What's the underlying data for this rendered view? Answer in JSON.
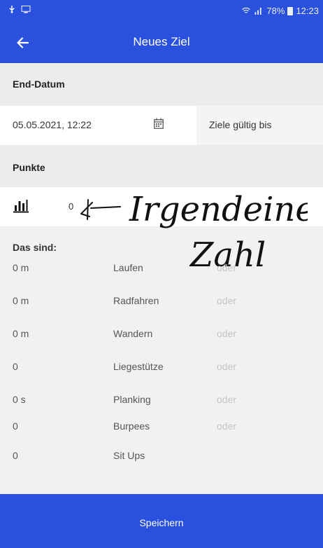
{
  "status_bar": {
    "battery": "78%",
    "time": "12:23"
  },
  "header": {
    "title": "Neues Ziel"
  },
  "sections": {
    "end_date": {
      "title": "End-Datum",
      "value": "05.05.2021, 12:22",
      "valid_label": "Ziele gültig bis"
    },
    "points": {
      "title": "Punkte",
      "value": "0"
    }
  },
  "annotation": {
    "line1": "Irgendeine",
    "line2": "Zahl"
  },
  "summary": {
    "title": "Das sind:",
    "rows": [
      {
        "amount": "0 m",
        "name": "Laufen",
        "oder": "oder"
      },
      {
        "amount": "0 m",
        "name": "Radfahren",
        "oder": "oder"
      },
      {
        "amount": "0 m",
        "name": "Wandern",
        "oder": "oder"
      },
      {
        "amount": "0",
        "name": "Liegestütze",
        "oder": "oder"
      },
      {
        "amount": "0 s",
        "name": "Planking",
        "oder": "oder"
      },
      {
        "amount": "0",
        "name": "Burpees",
        "oder": "oder"
      },
      {
        "amount": "0",
        "name": "Sit Ups",
        "oder": ""
      }
    ]
  },
  "footer": {
    "save_label": "Speichern"
  },
  "colors": {
    "primary": "#2951dd",
    "background": "#f1f1f1",
    "muted": "#c4c4c4"
  },
  "icons": [
    "back-arrow-icon",
    "calendar-icon",
    "bar-chart-icon"
  ]
}
